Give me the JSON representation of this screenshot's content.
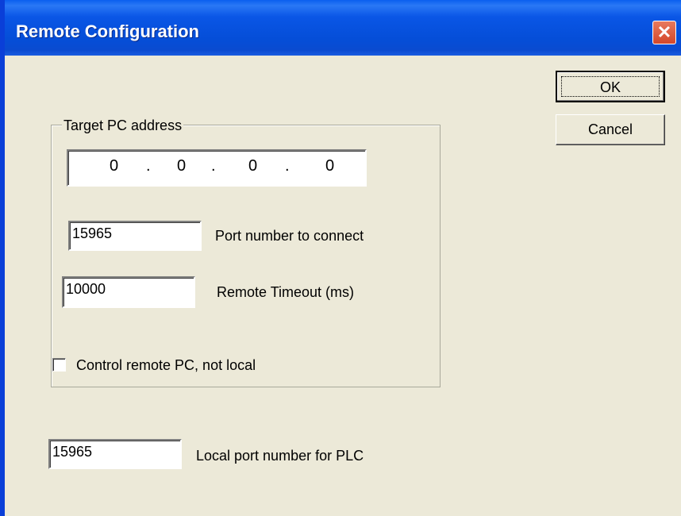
{
  "window": {
    "title": "Remote Configuration",
    "close_glyph": "✕"
  },
  "buttons": {
    "ok": "OK",
    "cancel": "Cancel"
  },
  "target_group": {
    "legend": "Target PC address",
    "ip": [
      "0",
      "0",
      "0",
      "0"
    ],
    "ip_separator": ".",
    "port_value": "15965",
    "port_label": "Port number to connect",
    "timeout_value": "10000",
    "timeout_label": "Remote Timeout (ms)"
  },
  "control_remote": {
    "label": "Control remote PC, not local",
    "checked": false
  },
  "local_port": {
    "value": "15965",
    "label": "Local port number for PLC"
  },
  "colors": {
    "titlebar": "#0a56e6",
    "dialog_bg": "#ece9d8",
    "close_button": "#d4472a"
  }
}
